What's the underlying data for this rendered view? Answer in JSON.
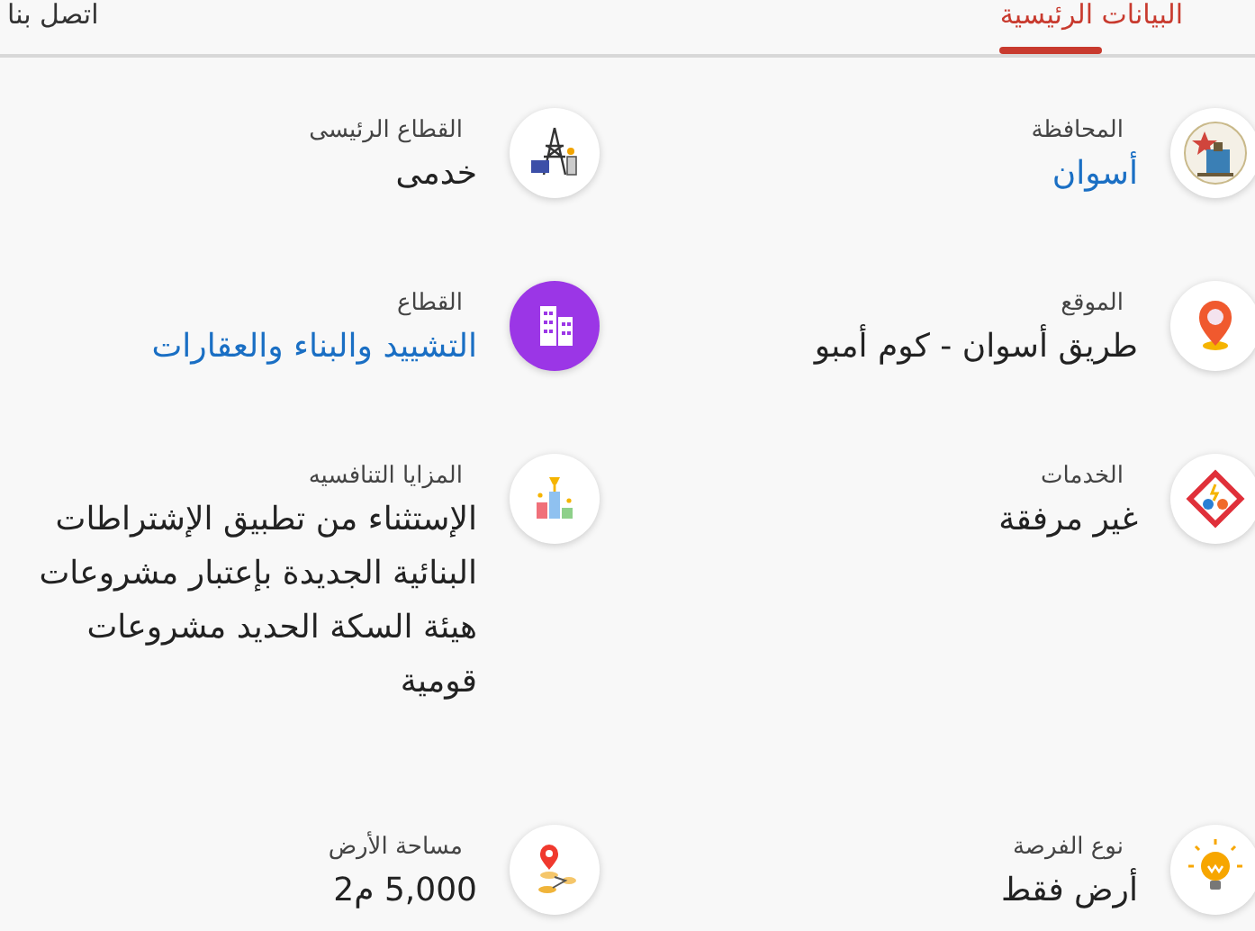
{
  "tabs": [
    {
      "label": "البيانات الرئيسية",
      "selected": true
    },
    {
      "label": "اتصل بنا",
      "selected": false
    }
  ],
  "items": [
    {
      "label": "المحافظة",
      "value": "أسوان",
      "link": true
    },
    {
      "label": "القطاع الرئيسى",
      "value": "خدمى",
      "link": false
    },
    {
      "label": "الموقع",
      "value": "طريق أسوان - كوم أمبو",
      "link": false
    },
    {
      "label": "القطاع",
      "value": "التشييد والبناء والعقارات",
      "link": true
    },
    {
      "label": "الخدمات",
      "value": "غير مرفقة",
      "link": false
    },
    {
      "label": "المزايا التنافسيه",
      "value": "الإستثناء من تطبيق الإشتراطات البنائية الجديدة بإعتبار مشروعات هيئة السكة الحديد مشروعات قومية",
      "link": false
    },
    {
      "label": "نوع الفرصة",
      "value": "أرض فقط",
      "link": false
    },
    {
      "label": "مساحة الأرض",
      "value": "5,000 م2",
      "link": false
    }
  ]
}
